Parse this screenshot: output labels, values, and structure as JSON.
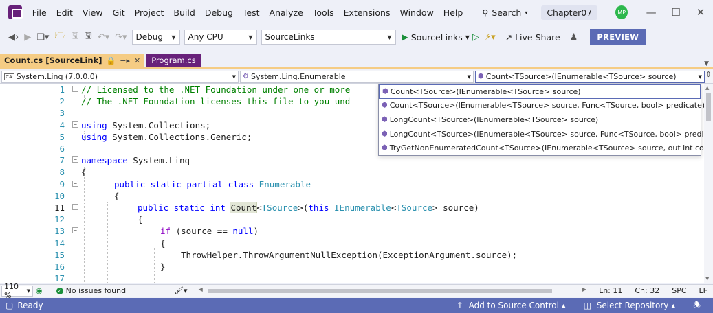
{
  "menu": [
    "File",
    "Edit",
    "View",
    "Git",
    "Project",
    "Build",
    "Debug",
    "Test",
    "Analyze",
    "Tools",
    "Extensions",
    "Window",
    "Help"
  ],
  "search_label": "Search",
  "solution_name": "Chapter07",
  "user_initials": "MP",
  "toolbar": {
    "config": "Debug",
    "platform": "Any CPU",
    "startup_project": "SourceLinks",
    "run_target": "SourceLinks",
    "live_share": "Live Share",
    "preview": "PREVIEW"
  },
  "tabs": {
    "active": "Count.cs [SourceLink]",
    "inactive": "Program.cs"
  },
  "navbar": {
    "assembly": "System.Linq (7.0.0.0)",
    "type": "System.Linq.Enumerable",
    "member": "Count<TSource>(IEnumerable<TSource> source)"
  },
  "dropdown_items": [
    "Count<TSource>(IEnumerable<TSource> source)",
    "Count<TSource>(IEnumerable<TSource> source, Func<TSource, bool> predicate)",
    "LongCount<TSource>(IEnumerable<TSource> source)",
    "LongCount<TSource>(IEnumerable<TSource> source, Func<TSource, bool> predicate)",
    "TryGetNonEnumeratedCount<TSource>(IEnumerable<TSource> source, out int count)"
  ],
  "code": {
    "line_numbers": [
      "1",
      "2",
      "3",
      "4",
      "5",
      "6",
      "7",
      "8",
      "9",
      "10",
      "11",
      "12",
      "13",
      "14",
      "15",
      "16",
      "17"
    ],
    "l1": "// Licensed to the .NET Foundation under one or more",
    "l2": "// The .NET Foundation licenses this file to you und",
    "l4_kw": "using",
    "l4_rest": " System.Collections;",
    "l5_kw": "using",
    "l5_rest": " System.Collections.Generic;",
    "l7_kw": "namespace",
    "l7_rest": " System.Linq",
    "brace_open": "{",
    "brace_close": "}",
    "l9_kw": "public static partial class",
    "l9_type": "Enumerable",
    "l11_kw": "public static int",
    "l11_name": "Count",
    "l11_lt": "<",
    "l11_tp": "TSource",
    "l11_gt": ">(",
    "l11_this": "this",
    "l11_ienum": "IEnumerable",
    "l11_lt2": "<",
    "l11_tp2": "TSource",
    "l11_tail": "> source)",
    "l13_if": "if",
    "l13_a": " (source == ",
    "l13_null": "null",
    "l13_b": ")",
    "l15": "ThrowHelper.ThrowArgumentNullException(ExceptionArgument.source);"
  },
  "status": {
    "zoom": "110 %",
    "issues": "No issues found",
    "line": "Ln: 11",
    "col": "Ch: 32",
    "spacing": "SPC",
    "eol": "LF",
    "ready": "Ready",
    "add_source_control": "Add to Source Control",
    "select_repo": "Select Repository"
  }
}
